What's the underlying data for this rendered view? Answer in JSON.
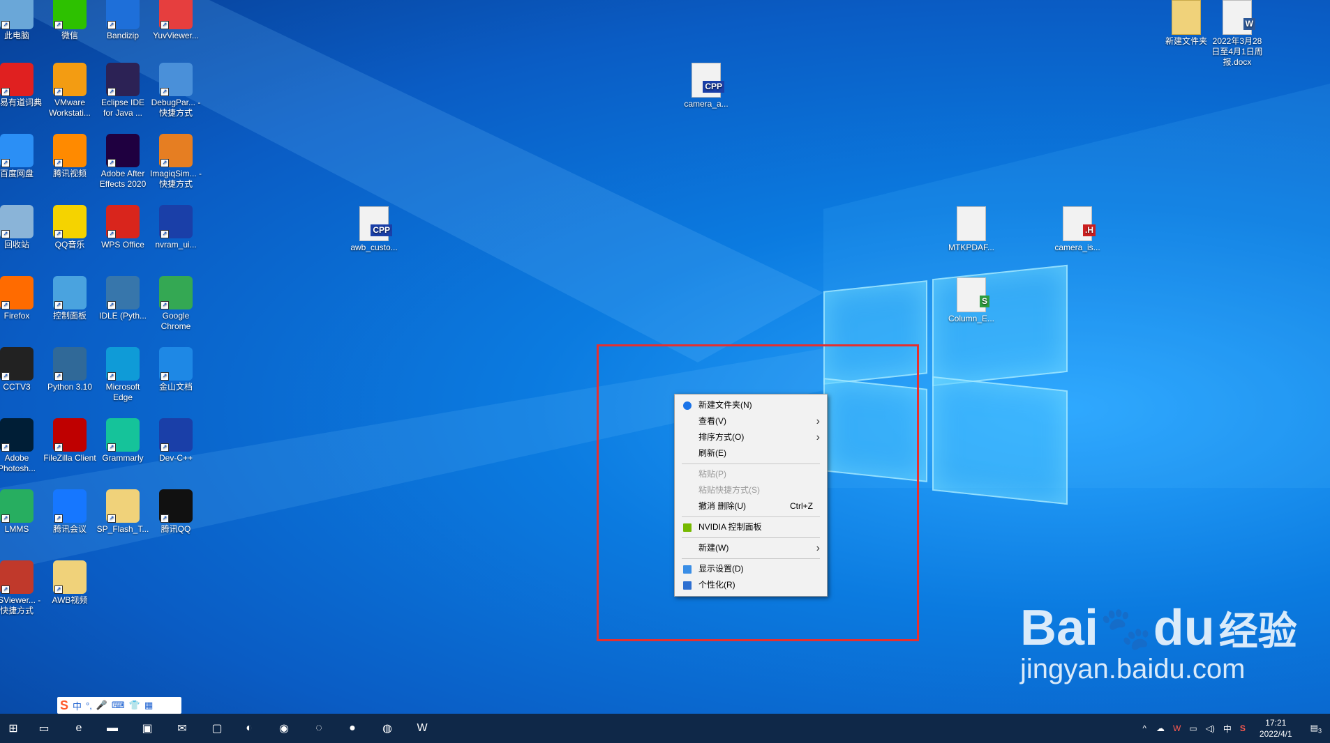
{
  "desktop": {
    "left_icons": [
      {
        "label": "此电脑",
        "icon": "computer-icon",
        "color": "#6aa7d8"
      },
      {
        "label": "微信",
        "icon": "wechat-icon",
        "color": "#2dc100"
      },
      {
        "label": "Bandizip",
        "icon": "bandizip-icon",
        "color": "#1e6fd9"
      },
      {
        "label": "YuvViewer...",
        "icon": "yuvviewer-icon",
        "color": "#e63e3e"
      },
      {
        "label": "网易有道词典",
        "icon": "youdao-icon",
        "color": "#e02020"
      },
      {
        "label": "VMware Workstati...",
        "icon": "vmware-icon",
        "color": "#f39c12"
      },
      {
        "label": "Eclipse IDE for Java ...",
        "icon": "eclipse-icon",
        "color": "#2c2255"
      },
      {
        "label": "DebugPar... - 快捷方式",
        "icon": "debugpar-icon",
        "color": "#4a90d9"
      },
      {
        "label": "百度网盘",
        "icon": "baidu-netdisk-icon",
        "color": "#2b8ff5"
      },
      {
        "label": "腾讯视频",
        "icon": "tencent-video-icon",
        "color": "#ff8a00"
      },
      {
        "label": "Adobe After Effects 2020",
        "icon": "after-effects-icon",
        "color": "#1f0040"
      },
      {
        "label": "ImagiqSim... - 快捷方式",
        "icon": "imagiqsim-icon",
        "color": "#e67e22"
      },
      {
        "label": "回收站",
        "icon": "recycle-bin-icon",
        "color": "#8ab4d8"
      },
      {
        "label": "QQ音乐",
        "icon": "qq-music-icon",
        "color": "#f5d300"
      },
      {
        "label": "WPS Office",
        "icon": "wps-icon",
        "color": "#d9251c"
      },
      {
        "label": "nvram_ui...",
        "icon": "cpp-file-icon",
        "color": "#1a3fa8"
      },
      {
        "label": "Firefox",
        "icon": "firefox-icon",
        "color": "#ff6b00"
      },
      {
        "label": "控制面板",
        "icon": "control-panel-icon",
        "color": "#4aa3df"
      },
      {
        "label": "IDLE (Pyth...",
        "icon": "idle-python-icon",
        "color": "#3776ab"
      },
      {
        "label": "Google Chrome",
        "icon": "chrome-icon",
        "color": "#34a853"
      },
      {
        "label": "CCTV3",
        "icon": "cctv3-icon",
        "color": "#222222"
      },
      {
        "label": "Python 3.10",
        "icon": "python-icon",
        "color": "#306998"
      },
      {
        "label": "Microsoft Edge",
        "icon": "edge-icon",
        "color": "#0f9bd7"
      },
      {
        "label": "金山文档",
        "icon": "kdocs-icon",
        "color": "#1e88e5"
      },
      {
        "label": "Adobe Photosh...",
        "icon": "photoshop-icon",
        "color": "#001e36"
      },
      {
        "label": "FileZilla Client",
        "icon": "filezilla-icon",
        "color": "#bf0000"
      },
      {
        "label": "Grammarly",
        "icon": "grammarly-icon",
        "color": "#15c39a"
      },
      {
        "label": "Dev-C++",
        "icon": "devcpp-icon",
        "color": "#1a3fa8"
      },
      {
        "label": "LMMS",
        "icon": "lmms-icon",
        "color": "#27ae60"
      },
      {
        "label": "腾讯会议",
        "icon": "tencent-meeting-icon",
        "color": "#1677ff"
      },
      {
        "label": "SP_Flash_T...",
        "icon": "folder-icon",
        "color": "#f0d27a"
      },
      {
        "label": "腾讯QQ",
        "icon": "qq-icon",
        "color": "#111111"
      },
      {
        "label": "FSViewer... - 快捷方式",
        "icon": "fsviewer-icon",
        "color": "#c0392b"
      },
      {
        "label": "AWB视频",
        "icon": "folder-icon",
        "color": "#f0d27a"
      }
    ],
    "files": [
      {
        "label": "camera_a...",
        "tag": "CPP",
        "tag_color": "#1a3fa8"
      },
      {
        "label": "awb_custo...",
        "tag": "CPP",
        "tag_color": "#1a3fa8"
      },
      {
        "label": "MTKPDAF...",
        "tag": "",
        "tag_color": ""
      },
      {
        "label": "camera_is...",
        "tag": ".H",
        "tag_color": "#cc1f1f"
      },
      {
        "label": "Column_E...",
        "tag": "S",
        "tag_color": "#2e9d3f"
      },
      {
        "label": "新建文件夹",
        "tag": "",
        "tag_color": ""
      },
      {
        "label": "2022年3月28日至4月1日周报.docx",
        "tag": "W",
        "tag_color": "#2b5797"
      }
    ]
  },
  "context_menu": {
    "items": [
      {
        "label": "新建文件夹(N)",
        "icon": "new-folder-icon",
        "disabled": false,
        "submenu": false,
        "shortcut": ""
      },
      {
        "label": "查看(V)",
        "icon": "",
        "disabled": false,
        "submenu": true,
        "shortcut": ""
      },
      {
        "label": "排序方式(O)",
        "icon": "",
        "disabled": false,
        "submenu": true,
        "shortcut": ""
      },
      {
        "label": "刷新(E)",
        "icon": "",
        "disabled": false,
        "submenu": false,
        "shortcut": ""
      },
      {
        "sep": true
      },
      {
        "label": "粘贴(P)",
        "icon": "",
        "disabled": true,
        "submenu": false,
        "shortcut": ""
      },
      {
        "label": "粘贴快捷方式(S)",
        "icon": "",
        "disabled": true,
        "submenu": false,
        "shortcut": ""
      },
      {
        "label": "撤消 删除(U)",
        "icon": "",
        "disabled": false,
        "submenu": false,
        "shortcut": "Ctrl+Z"
      },
      {
        "sep": true
      },
      {
        "label": "NVIDIA 控制面板",
        "icon": "nvidia-icon",
        "disabled": false,
        "submenu": false,
        "shortcut": ""
      },
      {
        "sep": true
      },
      {
        "label": "新建(W)",
        "icon": "",
        "disabled": false,
        "submenu": true,
        "shortcut": ""
      },
      {
        "sep": true
      },
      {
        "label": "显示设置(D)",
        "icon": "display-icon",
        "disabled": false,
        "submenu": false,
        "shortcut": ""
      },
      {
        "label": "个性化(R)",
        "icon": "personalize-icon",
        "disabled": false,
        "submenu": false,
        "shortcut": ""
      }
    ]
  },
  "ime_bar": {
    "mode": "中",
    "glyphs": [
      "S",
      "中",
      "°,",
      "🎤",
      "⌨",
      "👕",
      "▦"
    ]
  },
  "taskbar": {
    "apps": [
      {
        "icon": "windows-start-icon",
        "glyph": "⊞"
      },
      {
        "icon": "task-view-icon",
        "glyph": "▭"
      },
      {
        "icon": "edge-icon",
        "glyph": "e"
      },
      {
        "icon": "file-explorer-icon",
        "glyph": "▬"
      },
      {
        "icon": "store-icon",
        "glyph": "▣"
      },
      {
        "icon": "mail-icon",
        "glyph": "✉"
      },
      {
        "icon": "app-window-icon",
        "glyph": "▢"
      },
      {
        "icon": "imagiqsim-icon",
        "glyph": "◐"
      },
      {
        "icon": "fsviewer-icon",
        "glyph": "◉"
      },
      {
        "icon": "wechat-icon",
        "glyph": "◌"
      },
      {
        "icon": "qq-music-icon",
        "glyph": "●"
      },
      {
        "icon": "chrome-icon",
        "glyph": "◍"
      },
      {
        "icon": "wps-icon",
        "glyph": "W"
      }
    ],
    "tray": {
      "ime": "中",
      "time": "17:21",
      "date": "2022/4/1",
      "notification_count": "3"
    }
  },
  "watermark": {
    "brand": "Bai",
    "brand2": "du",
    "cn": "经验",
    "url": "jingyan.baidu.com"
  }
}
